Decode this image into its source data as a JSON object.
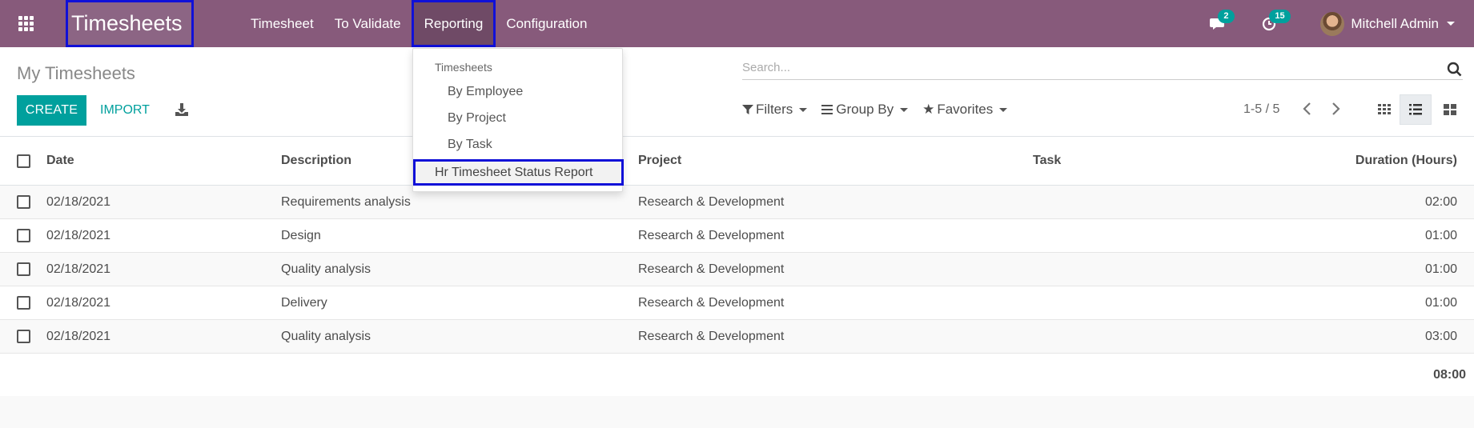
{
  "navbar": {
    "brand": "Timesheets",
    "menu": [
      {
        "label": "Timesheet"
      },
      {
        "label": "To Validate"
      },
      {
        "label": "Reporting"
      },
      {
        "label": "Configuration"
      }
    ],
    "messages_count": "2",
    "activities_count": "15",
    "user_name": "Mitchell Admin"
  },
  "control": {
    "title": "My Timesheets",
    "create_label": "CREATE",
    "import_label": "IMPORT",
    "search_placeholder": "Search...",
    "filters_label": "Filters",
    "groupby_label": "Group By",
    "favorites_label": "Favorites",
    "pager": "1-5 / 5"
  },
  "dropdown": {
    "header": "Timesheets",
    "items": [
      {
        "label": "By Employee"
      },
      {
        "label": "By Project"
      },
      {
        "label": "By Task"
      },
      {
        "label": "Hr Timesheet Status Report"
      }
    ]
  },
  "table": {
    "headers": {
      "date": "Date",
      "description": "Description",
      "project": "Project",
      "task": "Task",
      "duration": "Duration (Hours)"
    },
    "rows": [
      {
        "date": "02/18/2021",
        "description": "Requirements analysis",
        "project": "Research & Development",
        "task": "",
        "duration": "02:00"
      },
      {
        "date": "02/18/2021",
        "description": "Design",
        "project": "Research & Development",
        "task": "",
        "duration": "01:00"
      },
      {
        "date": "02/18/2021",
        "description": "Quality analysis",
        "project": "Research & Development",
        "task": "",
        "duration": "01:00"
      },
      {
        "date": "02/18/2021",
        "description": "Delivery",
        "project": "Research & Development",
        "task": "",
        "duration": "01:00"
      },
      {
        "date": "02/18/2021",
        "description": "Quality analysis",
        "project": "Research & Development",
        "task": "",
        "duration": "03:00"
      }
    ],
    "total": "08:00"
  },
  "colors": {
    "brand": "#875a7b",
    "accent": "#00a09d",
    "highlight": "#1010d8"
  },
  "icons": [
    "apps-icon",
    "chat-icon",
    "clock-icon",
    "download-icon",
    "search-icon",
    "filter-icon",
    "groupby-icon",
    "star-icon",
    "chevron-left-icon",
    "chevron-right-icon",
    "kanban-view-icon",
    "list-view-icon",
    "grid-view-icon"
  ]
}
